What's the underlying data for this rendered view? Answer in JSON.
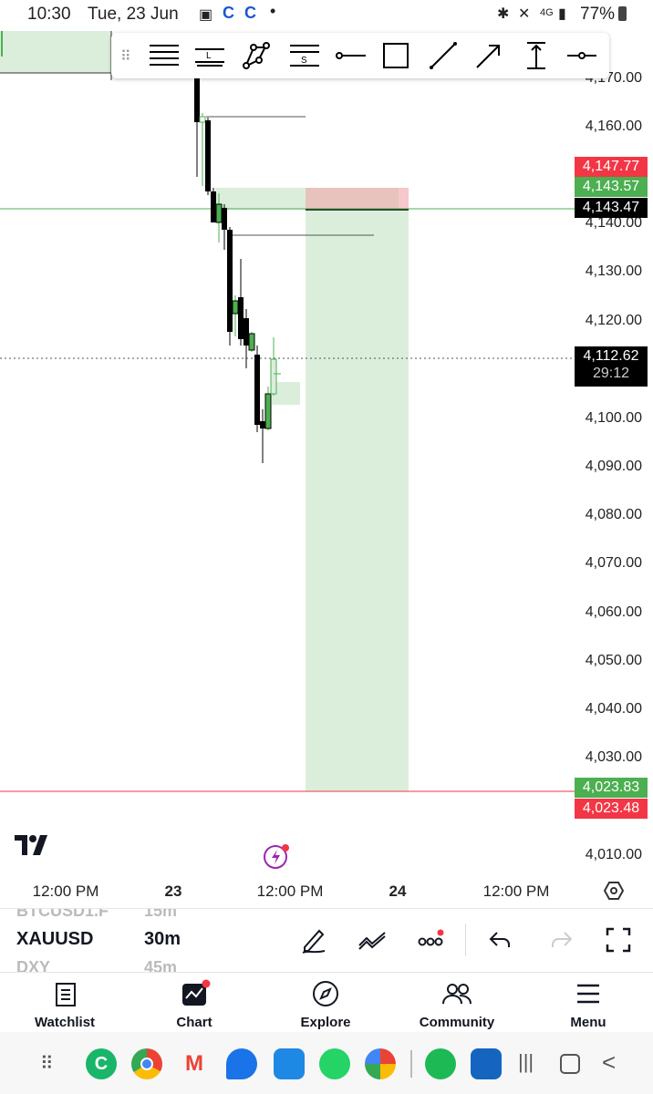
{
  "status": {
    "time": "10:30",
    "date": "Tue, 23 Jun",
    "battery": "77%"
  },
  "chart": {
    "price_ticks": [
      "4,170.00",
      "4,160.00",
      "4,140.00",
      "4,130.00",
      "4,120.00",
      "4,100.00",
      "4,090.00",
      "4,080.00",
      "4,070.00",
      "4,060.00",
      "4,050.00",
      "4,040.00",
      "4,030.00",
      "4,010.00"
    ],
    "price_labels": {
      "stop": "4,147.77",
      "entry": "4,143.57",
      "crosshair": "4,143.47",
      "last": "4,112.62",
      "countdown": "29:12",
      "target_top": "4,023.83",
      "target_bottom": "4,023.48"
    },
    "time_labels": [
      "12:00 PM",
      "23",
      "12:00 PM",
      "24",
      "12:00 PM"
    ],
    "colors": {
      "green": "#4caf50",
      "red": "#f23645",
      "zone_green": "#dbeedb",
      "zone_red": "#e8c3bd"
    }
  },
  "drawing_tools": [
    "horizontal-lines-icon",
    "long-position-icon",
    "path-icon",
    "short-position-icon",
    "horizontal-ray-icon",
    "rectangle-icon",
    "trend-line-icon",
    "arrow-icon",
    "price-range-icon",
    "horizontal-line-icon"
  ],
  "symbol_bar": {
    "prev_symbol": "BTCUSD1.F",
    "prev_interval": "15m",
    "symbol": "XAUUSD",
    "interval": "30m",
    "next_symbol": "DXY",
    "next_interval": "45m"
  },
  "nav": {
    "watchlist": "Watchlist",
    "chart": "Chart",
    "explore": "Explore",
    "community": "Community",
    "menu": "Menu"
  }
}
